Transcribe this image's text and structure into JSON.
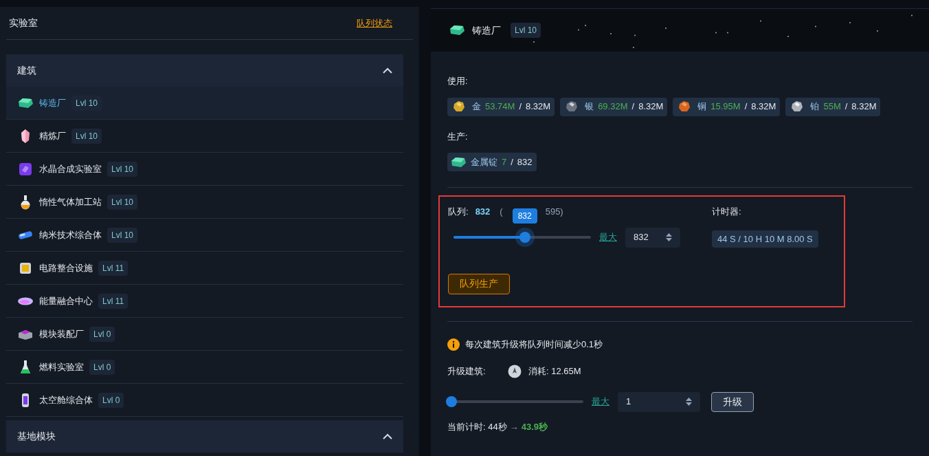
{
  "sidebar": {
    "title": "实验室",
    "queue_link": "队列状态",
    "sections": [
      {
        "title": "建筑",
        "expanded": true,
        "items": [
          {
            "name": "铸造厂",
            "level": "Lvl 10",
            "selected": true
          },
          {
            "name": "精炼厂",
            "level": "Lvl 10",
            "selected": false
          },
          {
            "name": "水晶合成实验室",
            "level": "Lvl 10",
            "selected": false
          },
          {
            "name": "惰性气体加工站",
            "level": "Lvl 10",
            "selected": false
          },
          {
            "name": "纳米技术综合体",
            "level": "Lvl 10",
            "selected": false
          },
          {
            "name": "电路整合设施",
            "level": "Lvl 11",
            "selected": false
          },
          {
            "name": "能量融合中心",
            "level": "Lvl 11",
            "selected": false
          },
          {
            "name": "模块装配厂",
            "level": "Lvl 0",
            "selected": false
          },
          {
            "name": "燃料实验室",
            "level": "Lvl 0",
            "selected": false
          },
          {
            "name": "太空舱综合体",
            "level": "Lvl 0",
            "selected": false
          }
        ]
      },
      {
        "title": "基地模块",
        "expanded": true
      }
    ]
  },
  "detail": {
    "title": "铸造厂",
    "level": "Lvl 10",
    "uses_label": "使用:",
    "uses": [
      {
        "name": "金",
        "have": "53.74M",
        "sep": "/",
        "need": "8.32M"
      },
      {
        "name": "银",
        "have": "69.32M",
        "sep": "/",
        "need": "8.32M"
      },
      {
        "name": "铜",
        "have": "15.95M",
        "sep": "/",
        "need": "8.32M"
      },
      {
        "name": "铂",
        "have": "55M",
        "sep": "/",
        "need": "8.32M"
      }
    ],
    "produces_label": "生产:",
    "produces": [
      {
        "name": "金属锭",
        "have": "7",
        "sep": "/",
        "need": "832"
      }
    ],
    "queue": {
      "label": "队列:",
      "value": "832",
      "max_open": "(",
      "max_close": "595)",
      "tooltip": "832",
      "level": 0.52,
      "max_link": "最大",
      "amount": "832",
      "timer_label": "计时器:",
      "timer": "44 S / 10 H 10 M 8.00 S",
      "button": "队列生产"
    },
    "upgrade": {
      "info": "每次建筑升级将队列时间减少0.1秒",
      "label": "升级建筑:",
      "cost": "消耗: 12.65M",
      "level": 0,
      "max_link": "最大",
      "amount": "1",
      "button": "升级",
      "current_label": "当前计时: 44秒",
      "arrow": "→",
      "new_time": "43.9秒"
    }
  }
}
